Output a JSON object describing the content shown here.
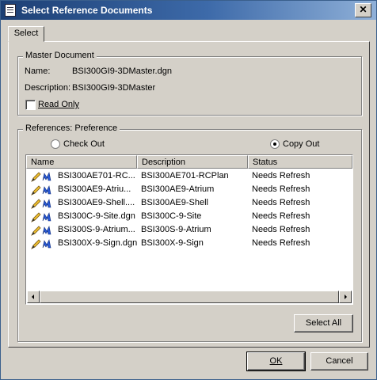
{
  "window": {
    "title": "Select Reference Documents",
    "close_glyph": "✕"
  },
  "tabs": [
    {
      "label": "Select"
    }
  ],
  "master": {
    "group_label": "Master Document",
    "name_label": "Name:",
    "name_value": "BSI300GI9-3DMaster.dgn",
    "description_label": "Description:",
    "description_value": "BSI300GI9-3DMaster",
    "read_only_label": "Read Only",
    "read_only_checked": false
  },
  "references": {
    "group_label": "References: Preference",
    "options": [
      {
        "label": "Check Out",
        "selected": false
      },
      {
        "label": "Copy Out",
        "selected": true
      }
    ],
    "columns": [
      "Name",
      "Description",
      "Status"
    ],
    "rows": [
      {
        "name": "BSI300AE701-RC...",
        "description": "BSI300AE701-RCPlan",
        "status": "Needs Refresh"
      },
      {
        "name": "BSI300AE9-Atriu...",
        "description": "BSI300AE9-Atrium",
        "status": "Needs Refresh"
      },
      {
        "name": "BSI300AE9-Shell....",
        "description": "BSI300AE9-Shell",
        "status": "Needs Refresh"
      },
      {
        "name": "BSI300C-9-Site.dgn",
        "description": "BSI300C-9-Site",
        "status": "Needs Refresh"
      },
      {
        "name": "BSI300S-9-Atrium...",
        "description": "BSI300S-9-Atrium",
        "status": "Needs Refresh"
      },
      {
        "name": "BSI300X-9-Sign.dgn",
        "description": "BSI300X-9-Sign",
        "status": "Needs Refresh"
      }
    ],
    "row_icons": [
      "pencil-icon",
      "microstation-icon"
    ],
    "select_all_label": "Select All"
  },
  "footer": {
    "ok_label": "OK",
    "cancel_label": "Cancel"
  }
}
